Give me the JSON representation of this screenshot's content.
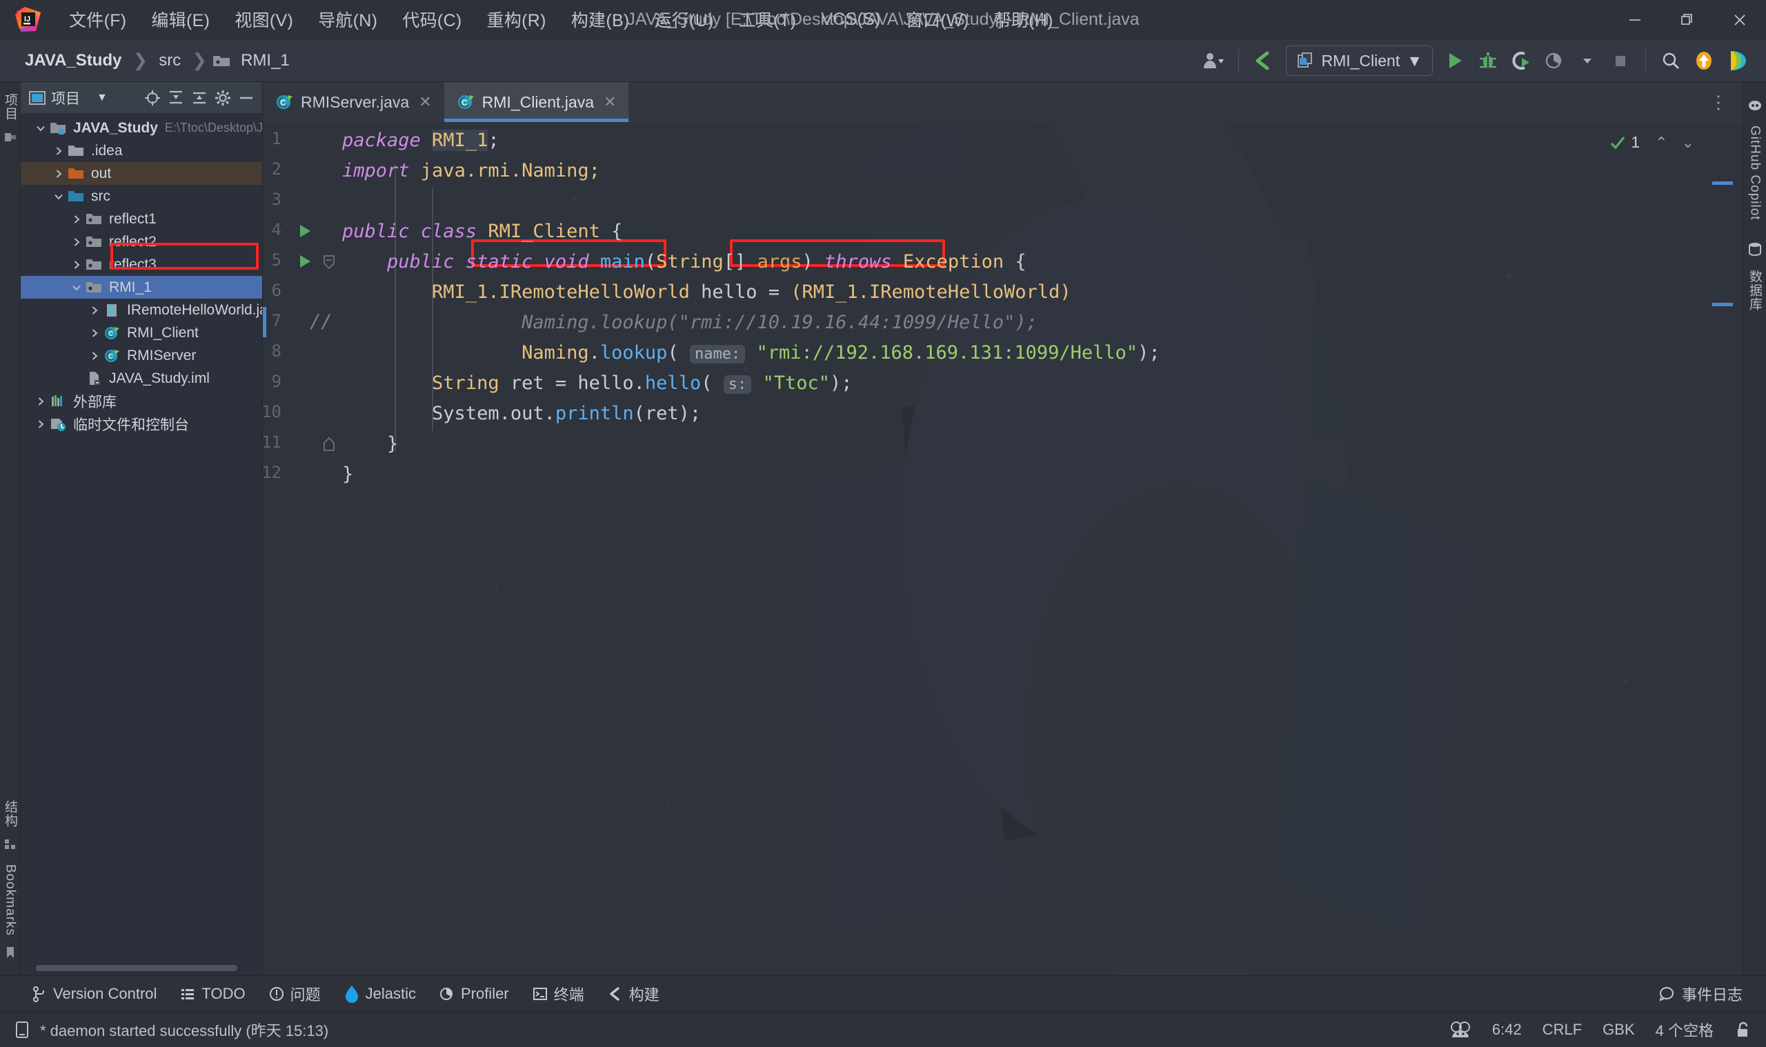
{
  "window": {
    "title": "JAVA_Study [E:\\Ttoc\\Desktop\\JAVA\\JAVA_Study] - RMI_Client.java",
    "minimize_label": "—",
    "restore_label": "❐",
    "close_label": "✕"
  },
  "menubar": {
    "logo_name": "intellij-idea-logo",
    "items": [
      {
        "label": "文件(F)"
      },
      {
        "label": "编辑(E)"
      },
      {
        "label": "视图(V)"
      },
      {
        "label": "导航(N)"
      },
      {
        "label": "代码(C)"
      },
      {
        "label": "重构(R)"
      },
      {
        "label": "构建(B)"
      },
      {
        "label": "运行(U)"
      },
      {
        "label": "工具(T)"
      },
      {
        "label": "VCS(S)"
      },
      {
        "label": "窗口(W)"
      },
      {
        "label": "帮助(H)"
      }
    ]
  },
  "navbar": {
    "breadcrumb": [
      {
        "label": "JAVA_Study",
        "bold": true
      },
      {
        "label": "src",
        "bold": false
      },
      {
        "label": "RMI_1",
        "bold": false,
        "icon": "package-folder-icon"
      }
    ],
    "separator": "❯"
  },
  "toolbar": {
    "profile_label": "user-profile-icon",
    "updates_label": "vcs-update-icon",
    "run_config": "RMI_Client",
    "run_config_dropdown": "▼",
    "run_label": "run-button",
    "debug_label": "debug-button",
    "run_coverage_label": "run-with-coverage-button",
    "profiler_label": "profiler-button",
    "stop_label": "stop-button",
    "search_label": "search-everywhere-button",
    "notification_label": "update-available-button",
    "plugin_label": "ide-feature-button"
  },
  "left_strip": {
    "labels": [
      "项目",
      "结构",
      "Bookmarks"
    ]
  },
  "right_strip": {
    "labels": [
      "GitHub Copilot",
      "数据库"
    ]
  },
  "project_panel": {
    "title": "项目",
    "title_dropdown": "▼",
    "header_buttons": [
      {
        "name": "select-opened-file-button",
        "glyph": "⊕"
      },
      {
        "name": "expand-all-button",
        "glyph": "⤓"
      },
      {
        "name": "collapse-all-button",
        "glyph": "⤒"
      },
      {
        "name": "settings-button",
        "glyph": "⚙"
      },
      {
        "name": "hide-button",
        "glyph": "—"
      }
    ],
    "tree": [
      {
        "label": "JAVA_Study",
        "path": "E:\\Ttoc\\Desktop\\JAVA\\JAVA",
        "indent": 0,
        "twisty": "v",
        "icon": "project-root-icon",
        "bold": true,
        "state": "normal"
      },
      {
        "label": ".idea",
        "path": "",
        "indent": 1,
        "twisty": ">",
        "icon": "folder-icon",
        "bold": false,
        "state": "normal"
      },
      {
        "label": "out",
        "path": "",
        "indent": 1,
        "twisty": ">",
        "icon": "excluded-folder-icon",
        "bold": false,
        "state": "excluded"
      },
      {
        "label": "src",
        "path": "",
        "indent": 1,
        "twisty": "v",
        "icon": "source-folder-icon",
        "bold": false,
        "state": "normal"
      },
      {
        "label": "reflect1",
        "path": "",
        "indent": 2,
        "twisty": ">",
        "icon": "package-folder-icon",
        "bold": false,
        "state": "normal"
      },
      {
        "label": "reflect2",
        "path": "",
        "indent": 2,
        "twisty": ">",
        "icon": "package-folder-icon",
        "bold": false,
        "state": "normal"
      },
      {
        "label": "reflect3",
        "path": "",
        "indent": 2,
        "twisty": ">",
        "icon": "package-folder-icon",
        "bold": false,
        "state": "normal"
      },
      {
        "label": "RMI_1",
        "path": "",
        "indent": 2,
        "twisty": "v",
        "icon": "package-folder-icon",
        "bold": false,
        "state": "selected"
      },
      {
        "label": "IRemoteHelloWorld.jar",
        "path": "",
        "indent": 3,
        "twisty": ">",
        "icon": "jar-file-icon",
        "bold": false,
        "state": "highlighted"
      },
      {
        "label": "RMI_Client",
        "path": "",
        "indent": 3,
        "twisty": ">",
        "icon": "java-class-icon",
        "bold": false,
        "state": "normal"
      },
      {
        "label": "RMIServer",
        "path": "",
        "indent": 3,
        "twisty": ">",
        "icon": "java-class-icon",
        "bold": false,
        "state": "normal"
      },
      {
        "label": "JAVA_Study.iml",
        "path": "",
        "indent": 2,
        "twisty": "",
        "icon": "iml-file-icon",
        "bold": false,
        "state": "normal"
      },
      {
        "label": "外部库",
        "path": "",
        "indent": 0,
        "twisty": ">",
        "icon": "external-libraries-icon",
        "bold": false,
        "state": "normal"
      },
      {
        "label": "临时文件和控制台",
        "path": "",
        "indent": 0,
        "twisty": ">",
        "icon": "scratches-icon",
        "bold": false,
        "state": "normal"
      }
    ]
  },
  "editor": {
    "tabs": [
      {
        "label": "RMIServer.java",
        "icon": "java-class-icon",
        "close": "✕",
        "active": false
      },
      {
        "label": "RMI_Client.java",
        "icon": "java-class-icon",
        "close": "✕",
        "active": true
      }
    ],
    "more_glyph": "⋮",
    "inspection_count": "1",
    "inspection_ok_glyph": "✔",
    "chevron_up": "⌃",
    "chevron_down": "⌄",
    "line_numbers": [
      "1",
      "2",
      "3",
      "4",
      "5",
      "6",
      "7",
      "8",
      "9",
      "10",
      "11",
      "12"
    ],
    "code_lines": [
      {
        "n": 1,
        "tokens": [
          {
            "t": "package ",
            "c": "k"
          },
          {
            "t": "RMI_1",
            "c": "ty selbg"
          },
          {
            "t": ";",
            "c": "pl"
          }
        ]
      },
      {
        "n": 2,
        "tokens": [
          {
            "t": "import ",
            "c": "k"
          },
          {
            "t": "java.rmi.Naming;",
            "c": "ty"
          }
        ]
      },
      {
        "n": 3,
        "tokens": []
      },
      {
        "n": 4,
        "tokens": [
          {
            "t": "public class ",
            "c": "k"
          },
          {
            "t": "RMI_Client ",
            "c": "ty"
          },
          {
            "t": "{",
            "c": "pl"
          }
        ]
      },
      {
        "n": 5,
        "tokens": [
          {
            "t": "    public static void ",
            "c": "k"
          },
          {
            "t": "main",
            "c": "fn"
          },
          {
            "t": "(",
            "c": "pl"
          },
          {
            "t": "String",
            "c": "ty"
          },
          {
            "t": "[] ",
            "c": "pl"
          },
          {
            "t": "args",
            "c": "pm"
          },
          {
            "t": ") ",
            "c": "pl"
          },
          {
            "t": "throws ",
            "c": "k"
          },
          {
            "t": "Exception ",
            "c": "ty"
          },
          {
            "t": "{",
            "c": "pl"
          }
        ]
      },
      {
        "n": 6,
        "tokens": [
          {
            "t": "        RMI_1.IRemoteHelloWorld",
            "c": "ty"
          },
          {
            "t": " hello = ",
            "c": "pl"
          },
          {
            "t": "(RMI_1.IRemoteHelloWorld)",
            "c": "ty"
          }
        ]
      },
      {
        "n": 7,
        "tokens": [
          {
            "t": "                Naming.lookup(\"rmi://10.19.16.44:1099/Hello\");",
            "c": "cm"
          }
        ]
      },
      {
        "n": 8,
        "tokens": [
          {
            "t": "                ",
            "c": "pl"
          },
          {
            "t": "Naming",
            "c": "ty"
          },
          {
            "t": ".",
            "c": "pl"
          },
          {
            "t": "lookup",
            "c": "fn"
          },
          {
            "t": "( ",
            "c": "pl"
          },
          {
            "t": "name:",
            "c": "hintbox"
          },
          {
            "t": " \"rmi://192.168.169.131:1099/Hello\"",
            "c": "st"
          },
          {
            "t": ");",
            "c": "pl"
          }
        ]
      },
      {
        "n": 9,
        "tokens": [
          {
            "t": "        ",
            "c": "pl"
          },
          {
            "t": "String",
            "c": "ty"
          },
          {
            "t": " ret = hello.",
            "c": "pl"
          },
          {
            "t": "hello",
            "c": "fn"
          },
          {
            "t": "( ",
            "c": "pl"
          },
          {
            "t": "s:",
            "c": "hintbox"
          },
          {
            "t": " \"Ttoc\"",
            "c": "st"
          },
          {
            "t": ");",
            "c": "pl"
          }
        ]
      },
      {
        "n": 10,
        "tokens": [
          {
            "t": "        System.out.",
            "c": "pl"
          },
          {
            "t": "println",
            "c": "fn"
          },
          {
            "t": "(ret);",
            "c": "pl"
          }
        ]
      },
      {
        "n": 11,
        "tokens": [
          {
            "t": "    }",
            "c": "pl"
          }
        ]
      },
      {
        "n": 12,
        "tokens": [
          {
            "t": "}",
            "c": "pl"
          }
        ]
      }
    ],
    "comment_marker": "//",
    "gutter_run_glyph": "▶",
    "annotations": [
      {
        "name": "red-highlight-declared-type",
        "text": "RMI_1.IRemoteHelloWorld"
      },
      {
        "name": "red-highlight-cast-type",
        "text": "(RMI_1.IRemoteHelloWorld)"
      },
      {
        "name": "red-highlight-jar-entry",
        "text": "IRemoteHelloWorld.jar"
      }
    ]
  },
  "toolwindow_bar": {
    "items": [
      {
        "label": "Version Control",
        "icon": "branch-icon"
      },
      {
        "label": "TODO",
        "icon": "todo-icon"
      },
      {
        "label": "问题",
        "icon": "problems-icon"
      },
      {
        "label": "Jelastic",
        "icon": "jelastic-icon"
      },
      {
        "label": "Profiler",
        "icon": "profiler-icon"
      },
      {
        "label": "终端",
        "icon": "terminal-icon"
      },
      {
        "label": "构建",
        "icon": "build-icon"
      }
    ],
    "right_item": {
      "label": "事件日志",
      "icon": "event-log-icon"
    }
  },
  "statusbar": {
    "message": "* daemon started successfully (昨天 15:13)",
    "message_icon": "console-icon",
    "right": [
      {
        "label": "",
        "name": "code-with-me-icon"
      },
      {
        "label": "6:42",
        "name": "caret-position"
      },
      {
        "label": "CRLF",
        "name": "line-separator"
      },
      {
        "label": "GBK",
        "name": "file-encoding"
      },
      {
        "label": "4 个空格",
        "name": "indent-setting"
      },
      {
        "label": "",
        "name": "lock-icon"
      }
    ]
  }
}
